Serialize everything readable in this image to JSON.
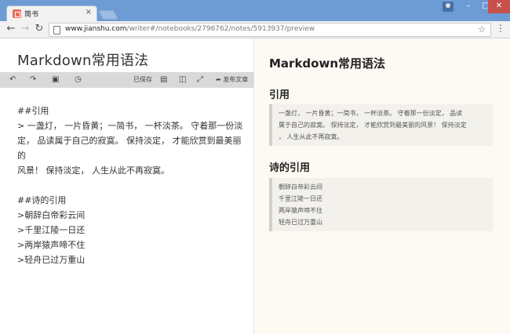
{
  "browser": {
    "tab_title": "简书",
    "tab_close": "×",
    "url_host": "www.jianshu.com",
    "url_path": "/writer#/notebooks/2796762/notes/5913937/preview",
    "window_min": "–",
    "window_max": "□",
    "window_close": "✕"
  },
  "editor": {
    "title": "Markdown常用语法",
    "toolbar": {
      "saved_label": "已保存",
      "publish_label": "发布文章"
    },
    "lines": [
      "##引用",
      "> 一盏灯， 一片昏黄；一简书， 一杯淡茶。 守着那一份淡",
      "定， 品读属于自己的寂寞。 保持淡定， 才能欣赏到最美丽的",
      "风景！ 保持淡定， 人生从此不再寂寞。",
      "",
      "##诗的引用",
      ">朝辞白帝彩云间",
      ">千里江陵一日还",
      ">两岸猿声啼不住",
      ">轻舟已过万重山"
    ]
  },
  "preview": {
    "title": "Markdown常用语法",
    "section1": {
      "heading": "引用",
      "quote_lines": [
        "一盏灯， 一片昏黄；一简书， 一杯淡茶。 守着那一份淡定， 品读",
        "属于自己的寂寞。 保持淡定， 才能欣赏到最美丽的风景！ 保持淡定",
        "， 人生从此不再寂寞。"
      ]
    },
    "section2": {
      "heading": "诗的引用",
      "quote_lines": [
        "朝辞白帝彩云间",
        "千里江陵一日还",
        "两岸猿声啼不住",
        "轻舟已过万重山"
      ]
    }
  }
}
